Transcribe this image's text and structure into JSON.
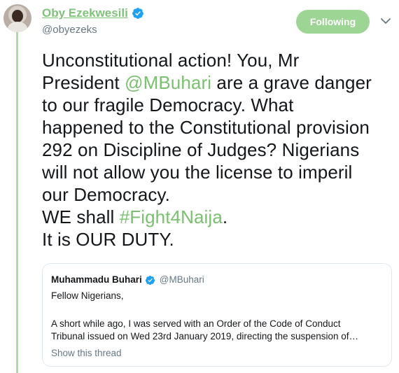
{
  "author": {
    "display_name": "Oby Ezekwesili",
    "handle": "@obyezeks"
  },
  "follow_button": {
    "label": "Following"
  },
  "tweet": {
    "line1": "Unconstitutional action! You,  Mr",
    "line2_pre": "President ",
    "mention": "@MBuhari",
    "line2_post": " are a grave danger",
    "line3": "to our fragile Democracy. What",
    "line4": "happened to the Constitutional provision",
    "line5": "292 on Discipline of Judges? Nigerians",
    "line6": "will not allow you the license to imperil",
    "line7": "our Democracy.",
    "line8_pre": "WE shall ",
    "hashtag": "#Fight4Naija",
    "line8_post": ".",
    "line9": "It is OUR DUTY."
  },
  "quoted_tweet": {
    "display_name": "Muhammadu Buhari",
    "handle": "@MBuhari",
    "line1": "Fellow Nigerians,",
    "line2": "A short while ago, I was served with an Order of the Code of Conduct",
    "line3": "Tribunal issued on Wed 23rd January 2019, directing the suspension of…",
    "show_thread": "Show this thread"
  },
  "colors": {
    "accent_green": "#79c16f",
    "follow_button_bg": "#9dd594",
    "thread_line": "#a9dba3",
    "verified_blue": "#1da1f2",
    "secondary_text": "#657786"
  },
  "icons": {
    "verified": "verified-badge-icon",
    "caret": "chevron-down-icon"
  }
}
